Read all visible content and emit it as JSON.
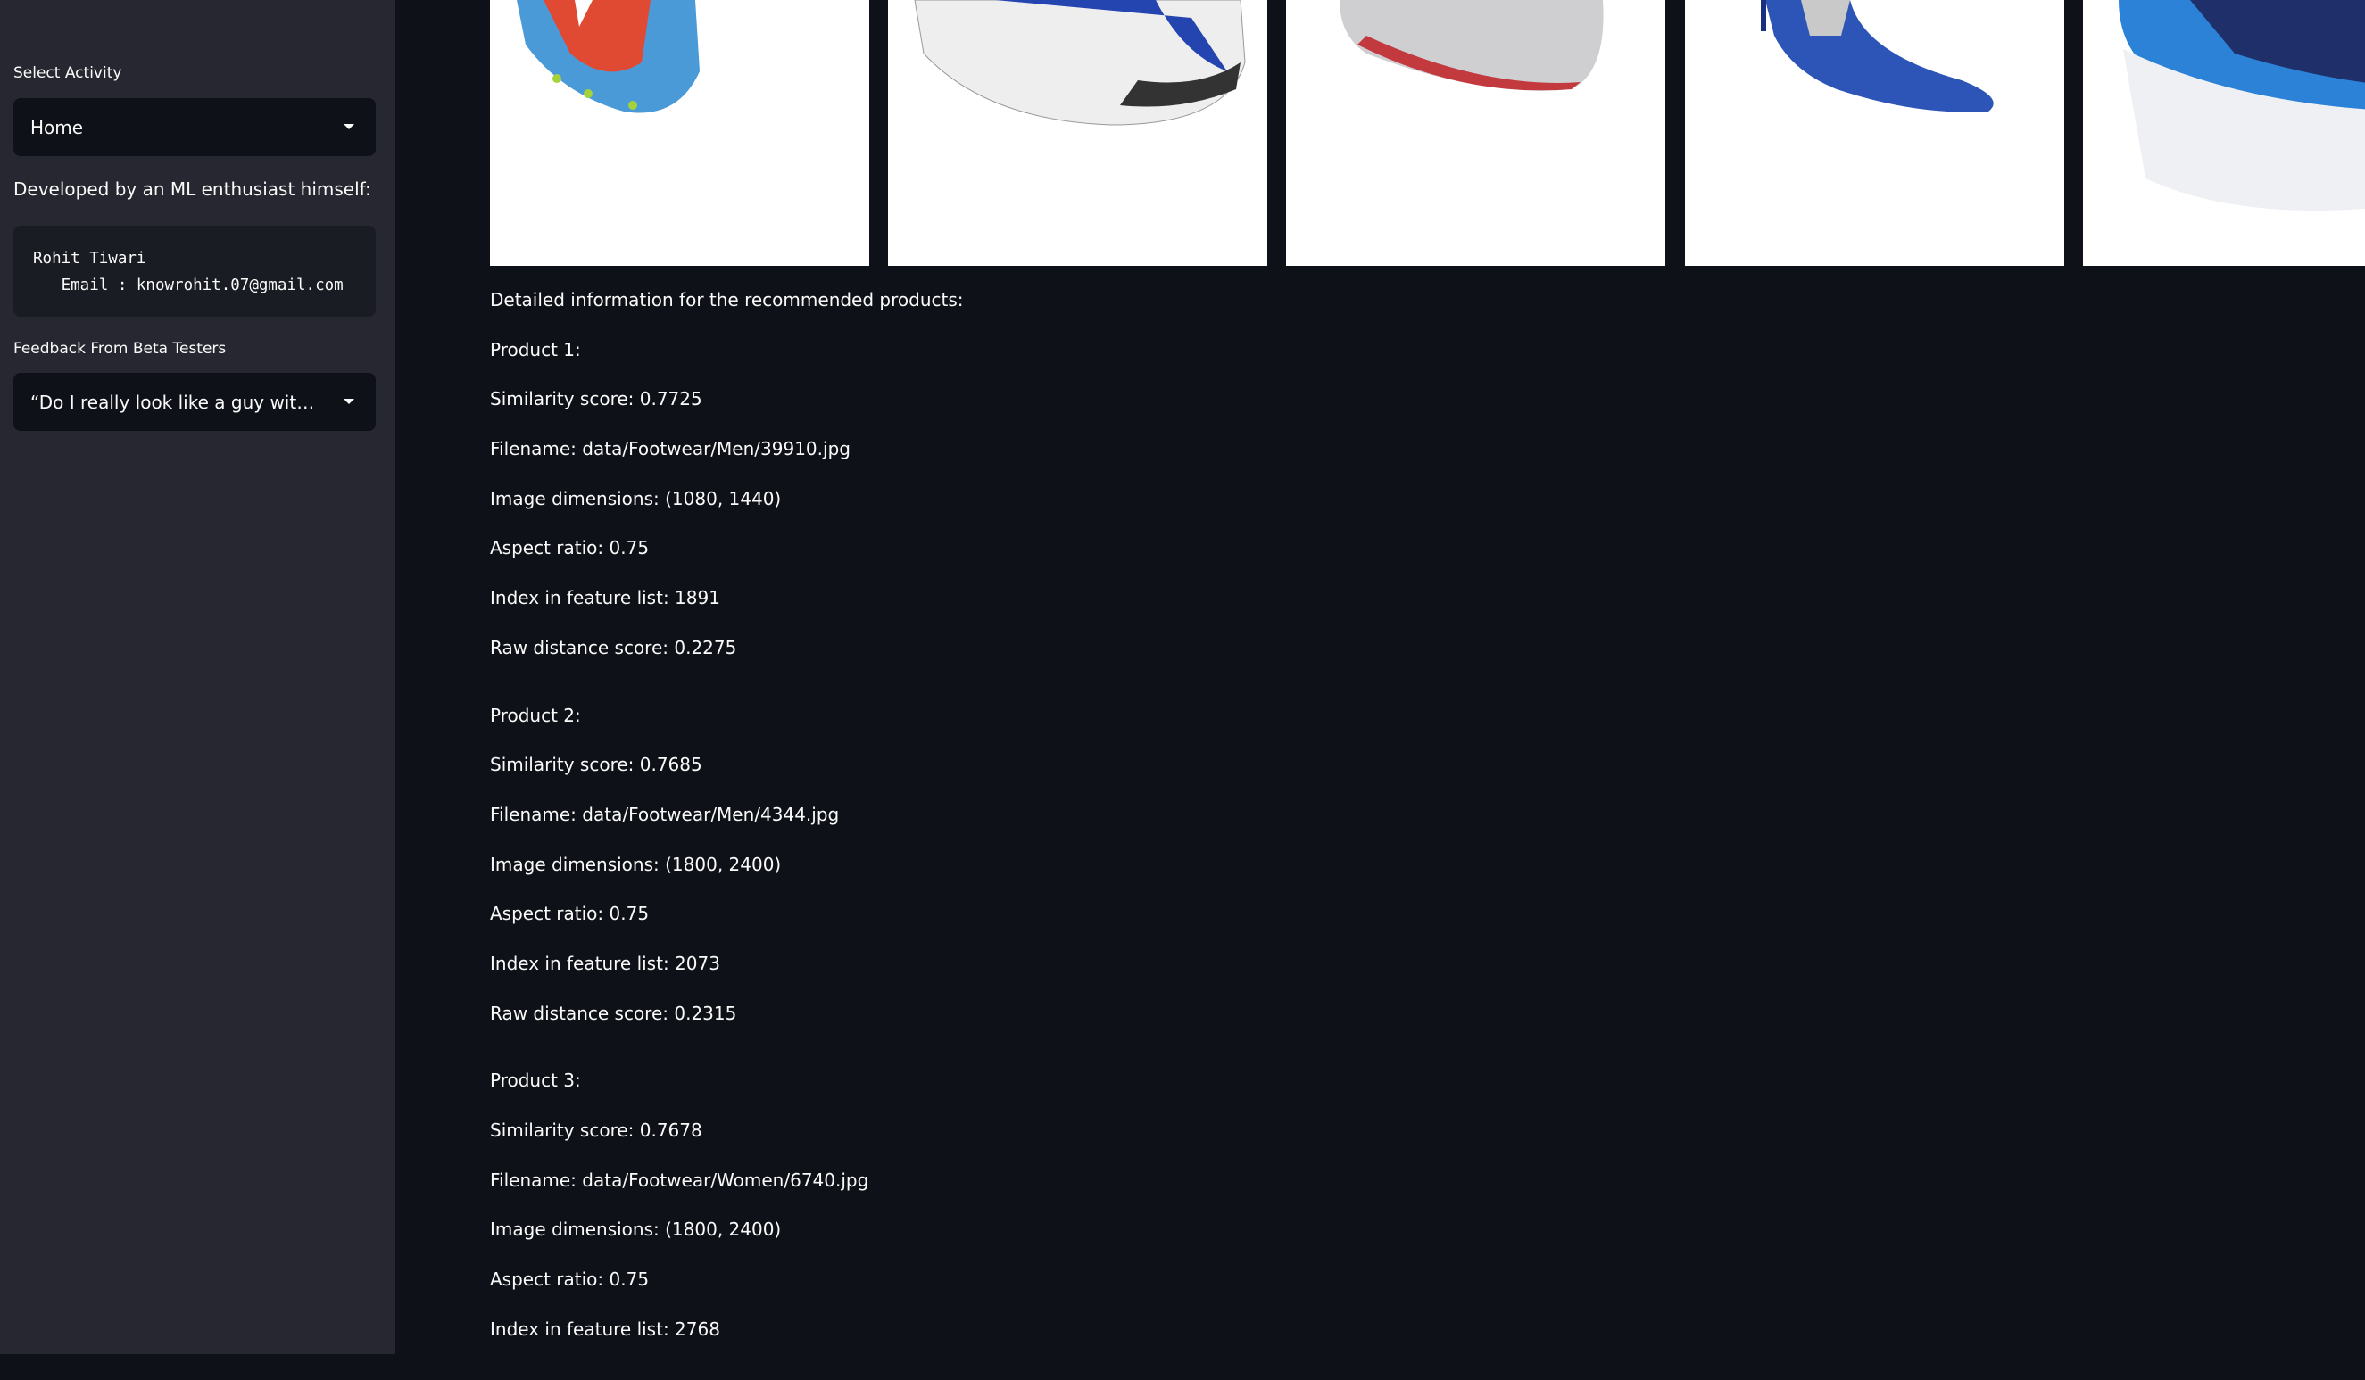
{
  "sidebar": {
    "select_activity_label": "Select Activity",
    "select_activity_value": "Home",
    "developer_text": "Developed by an ML enthusiast himself:",
    "developer_code": "Rohit Tiwari\n   Email : knowrohit.07@gmail.com",
    "feedback_label": "Feedback From Beta Testers",
    "feedback_value": "“Do I really look like a guy with a plan? You know what I am? I'm a dog chasing cars.”"
  },
  "main": {
    "images": [
      {
        "icon": "football-boot-red-blue"
      },
      {
        "icon": "running-shoe-white-blue"
      },
      {
        "icon": "running-shoe-grey-red"
      },
      {
        "icon": "sandal-heel-blue"
      },
      {
        "icon": "running-shoe-blue"
      }
    ],
    "details_heading": "Detailed information for the recommended products:",
    "products": [
      {
        "title": "Product 1:",
        "similarity": "Similarity score: 0.7725",
        "filename": "Filename: data/Footwear/Men/39910.jpg",
        "dimensions": "Image dimensions: (1080, 1440)",
        "aspect": "Aspect ratio: 0.75",
        "index": "Index in feature list: 1891",
        "distance": "Raw distance score: 0.2275"
      },
      {
        "title": "Product 2:",
        "similarity": "Similarity score: 0.7685",
        "filename": "Filename: data/Footwear/Men/4344.jpg",
        "dimensions": "Image dimensions: (1800, 2400)",
        "aspect": "Aspect ratio: 0.75",
        "index": "Index in feature list: 2073",
        "distance": "Raw distance score: 0.2315"
      },
      {
        "title": "Product 3:",
        "similarity": "Similarity score: 0.7678",
        "filename": "Filename: data/Footwear/Women/6740.jpg",
        "dimensions": "Image dimensions: (1800, 2400)",
        "aspect": "Aspect ratio: 0.75",
        "index": "Index in feature list: 2768"
      }
    ]
  }
}
